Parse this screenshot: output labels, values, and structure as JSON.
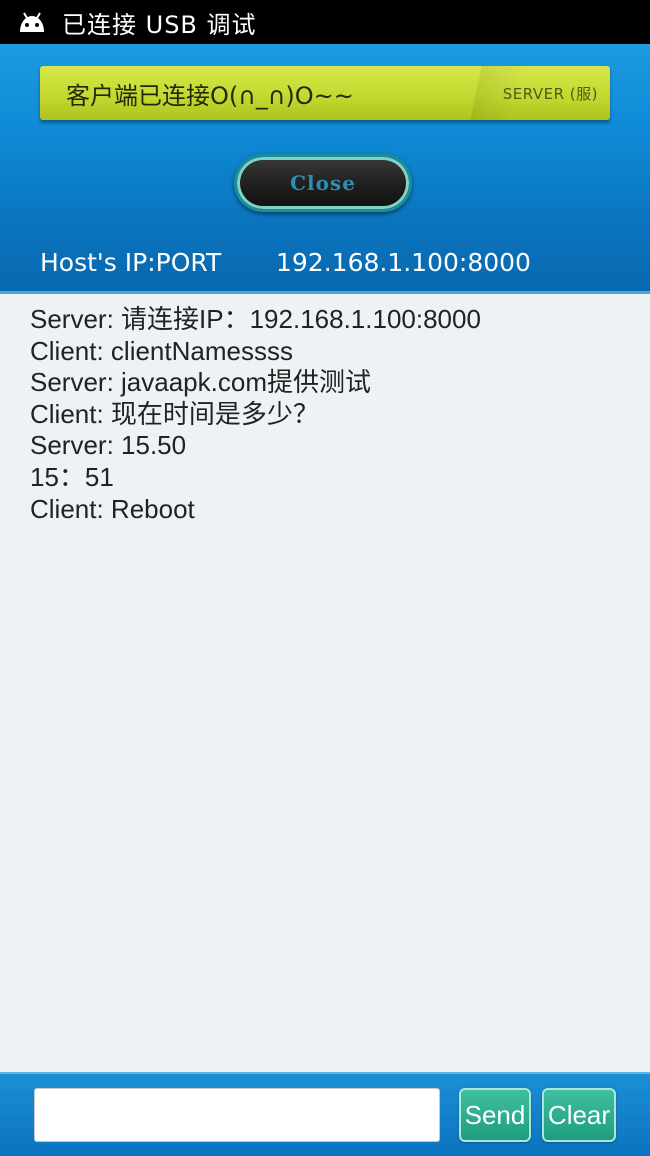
{
  "status_bar": {
    "text": "已连接 USB 调试",
    "icon": "android-icon"
  },
  "banner": {
    "status": "客户端已连接O(∩_∩)O~~",
    "mode": "SERVER (服)"
  },
  "close_label": "Close",
  "host": {
    "label": "Host's IP:PORT",
    "value": "192.168.1.100:8000"
  },
  "messages": [
    "Server: 请连接IP：192.168.1.100:8000",
    "Client: clientNamessss",
    "Server: javaapk.com提供测试",
    "Client: 现在时间是多少？",
    "Server: 15.50",
    "15：51",
    "Client: Reboot"
  ],
  "input": {
    "value": "",
    "placeholder": ""
  },
  "buttons": {
    "send": "Send",
    "clear": "Clear"
  },
  "colors": {
    "header_blue": "#0f8ad6",
    "banner_green": "#c4d930",
    "button_teal": "#1e9c7f"
  }
}
